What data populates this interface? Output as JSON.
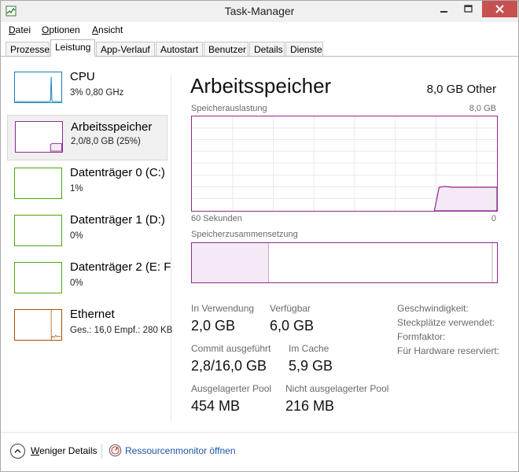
{
  "window": {
    "title": "Task-Manager"
  },
  "menu": {
    "items": [
      {
        "label": "Datei",
        "accel": "D"
      },
      {
        "label": "Optionen",
        "accel": "O"
      },
      {
        "label": "Ansicht",
        "accel": "A"
      }
    ]
  },
  "tabs": [
    {
      "label": "Prozesse",
      "active": false
    },
    {
      "label": "Leistung",
      "active": true
    },
    {
      "label": "App-Verlauf",
      "active": false
    },
    {
      "label": "Autostart",
      "active": false
    },
    {
      "label": "Benutzer",
      "active": false
    },
    {
      "label": "Details",
      "active": false
    },
    {
      "label": "Dienste",
      "active": false
    }
  ],
  "sidebar": {
    "items": [
      {
        "name": "CPU",
        "sub": "3% 0,80 GHz",
        "color": "#117dbb",
        "selected": false
      },
      {
        "name": "Arbeitsspeicher",
        "sub": "2,0/8,0 GB (25%)",
        "color": "#8b2a8f",
        "selected": true
      },
      {
        "name": "Datenträger 0 (C:)",
        "sub": "1%",
        "color": "#4da60c",
        "selected": false
      },
      {
        "name": "Datenträger 1 (D:)",
        "sub": "0%",
        "color": "#4da60c",
        "selected": false
      },
      {
        "name": "Datenträger 2 (E: F",
        "sub": "0%",
        "color": "#4da60c",
        "selected": false
      },
      {
        "name": "Ethernet",
        "sub": "Ges.: 16,0  Empf.: 280 KB",
        "color": "#a74f01",
        "selected": false
      }
    ]
  },
  "main": {
    "title": "Arbeitsspeicher",
    "spec": "8,0 GB Other",
    "usage_label": "Speicherauslastung",
    "usage_max": "8,0 GB",
    "time_left": "60 Sekunden",
    "time_right": "0",
    "composition_label": "Speicherzusammensetzung",
    "accent": "#8b2a8f"
  },
  "usage_level": 0.25,
  "stats": {
    "in_use_label": "In Verwendung",
    "in_use_value": "2,0 GB",
    "available_label": "Verfügbar",
    "available_value": "6,0 GB",
    "commit_label": "Commit ausgeführt",
    "commit_value": "2,8/16,0 GB",
    "cached_label": "Im Cache",
    "cached_value": "5,9 GB",
    "paged_label": "Ausgelagerter Pool",
    "paged_value": "454 MB",
    "nonpaged_label": "Nicht ausgelagerter Pool",
    "nonpaged_value": "216 MB"
  },
  "properties": [
    "Geschwindigkeit:",
    "Steckplätze verwendet:",
    "Formfaktor:",
    "Für Hardware reserviert:"
  ],
  "footer": {
    "less_details": "Weniger Details",
    "less_details_accel": "W",
    "resource_monitor": "Ressourcenmonitor öffnen"
  }
}
